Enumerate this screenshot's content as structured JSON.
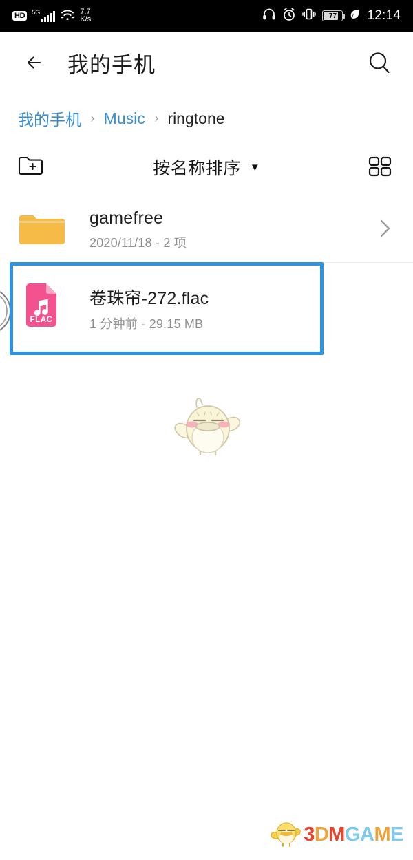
{
  "status_bar": {
    "hd_label": "HD",
    "network_type": "5G",
    "signal_icon": "signal-bars-icon",
    "wifi_icon": "wifi-icon",
    "data_speed_value": "7.7",
    "data_speed_unit": "K/s",
    "headphone_icon": "headphone-icon",
    "alarm_icon": "alarm-clock-icon",
    "vibrate_icon": "vibrate-icon",
    "battery_level": "77",
    "power_saving_icon": "leaf-icon",
    "time": "12:14"
  },
  "app_bar": {
    "back_icon": "back-arrow-icon",
    "title": "我的手机",
    "search_icon": "search-icon"
  },
  "breadcrumb": {
    "items": [
      {
        "label": "我的手机",
        "current": false
      },
      {
        "label": "Music",
        "current": false
      },
      {
        "label": "ringtone",
        "current": true
      }
    ],
    "separator": "›"
  },
  "toolbar": {
    "new_folder_icon": "new-folder-icon",
    "sort_label": "按名称排序",
    "sort_caret": "▼",
    "grid_view_icon": "grid-view-icon"
  },
  "file_list": [
    {
      "icon": "folder-icon",
      "name": "gamefree",
      "meta": "2020/11/18 - 2 项",
      "has_chevron": true,
      "chevron_icon": "chevron-right-icon"
    },
    {
      "icon": "flac-audio-file-icon",
      "icon_label": "FLAC",
      "name": "卷珠帘-272.flac",
      "meta": "1 分钟前 - 29.15 MB",
      "has_chevron": false,
      "highlighted": true
    }
  ],
  "mascot": {
    "icon": "chick-mascot-illustration"
  },
  "watermark": {
    "icon": "chick-logo-icon",
    "letters": [
      {
        "char": "3",
        "color": "#e8452c"
      },
      {
        "char": "D",
        "color": "#f0a33a"
      },
      {
        "char": "M",
        "color": "#e8452c"
      },
      {
        "char": "G",
        "color": "#7fc9ef"
      },
      {
        "char": "A",
        "color": "#7fc9ef"
      },
      {
        "char": "M",
        "color": "#f0a33a"
      },
      {
        "char": "E",
        "color": "#7fc9ef"
      }
    ]
  },
  "colors": {
    "accent_blue": "#3a8fd4",
    "highlight_blue": "#2e93e0",
    "folder_yellow": "#f5bb46",
    "flac_pink": "#f4518f",
    "status_bar_bg": "#000000"
  }
}
